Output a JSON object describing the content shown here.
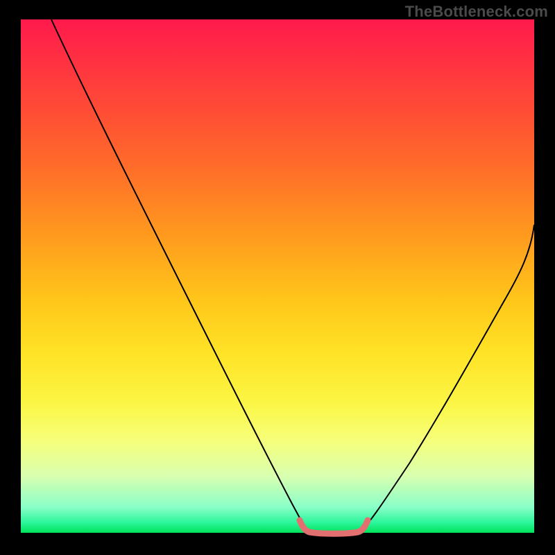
{
  "watermark": "TheBottleneck.com",
  "chart_data": {
    "type": "line",
    "title": "",
    "xlabel": "",
    "ylabel": "",
    "xlim": [
      0,
      100
    ],
    "ylim": [
      0,
      100
    ],
    "background_gradient": {
      "orientation": "vertical",
      "stops": [
        {
          "pos": 0,
          "color": "#ff1a4d"
        },
        {
          "pos": 12,
          "color": "#ff3c3c"
        },
        {
          "pos": 28,
          "color": "#ff6a2a"
        },
        {
          "pos": 42,
          "color": "#ff9a1e"
        },
        {
          "pos": 55,
          "color": "#ffc71a"
        },
        {
          "pos": 65,
          "color": "#ffe326"
        },
        {
          "pos": 75,
          "color": "#fbf646"
        },
        {
          "pos": 82,
          "color": "#f6ff7a"
        },
        {
          "pos": 89,
          "color": "#d8ffb0"
        },
        {
          "pos": 95,
          "color": "#8affc8"
        },
        {
          "pos": 98,
          "color": "#2cf59b"
        },
        {
          "pos": 100,
          "color": "#00e35c"
        }
      ]
    },
    "series": [
      {
        "name": "left-descent",
        "x": [
          6,
          12,
          20,
          28,
          36,
          44,
          50,
          54,
          56
        ],
        "y": [
          100,
          87,
          72,
          56,
          40,
          24,
          10,
          3,
          0
        ]
      },
      {
        "name": "basin",
        "x": [
          56,
          58,
          60,
          62,
          64,
          66
        ],
        "y": [
          0,
          0,
          0,
          0,
          0,
          0
        ]
      },
      {
        "name": "right-ascent",
        "x": [
          66,
          70,
          76,
          82,
          88,
          94,
          100
        ],
        "y": [
          0,
          6,
          16,
          27,
          38,
          49,
          60
        ]
      }
    ],
    "annotations": [
      {
        "name": "optimal-basin-highlight",
        "x_range": [
          54,
          67
        ],
        "color": "#e37070"
      }
    ]
  }
}
